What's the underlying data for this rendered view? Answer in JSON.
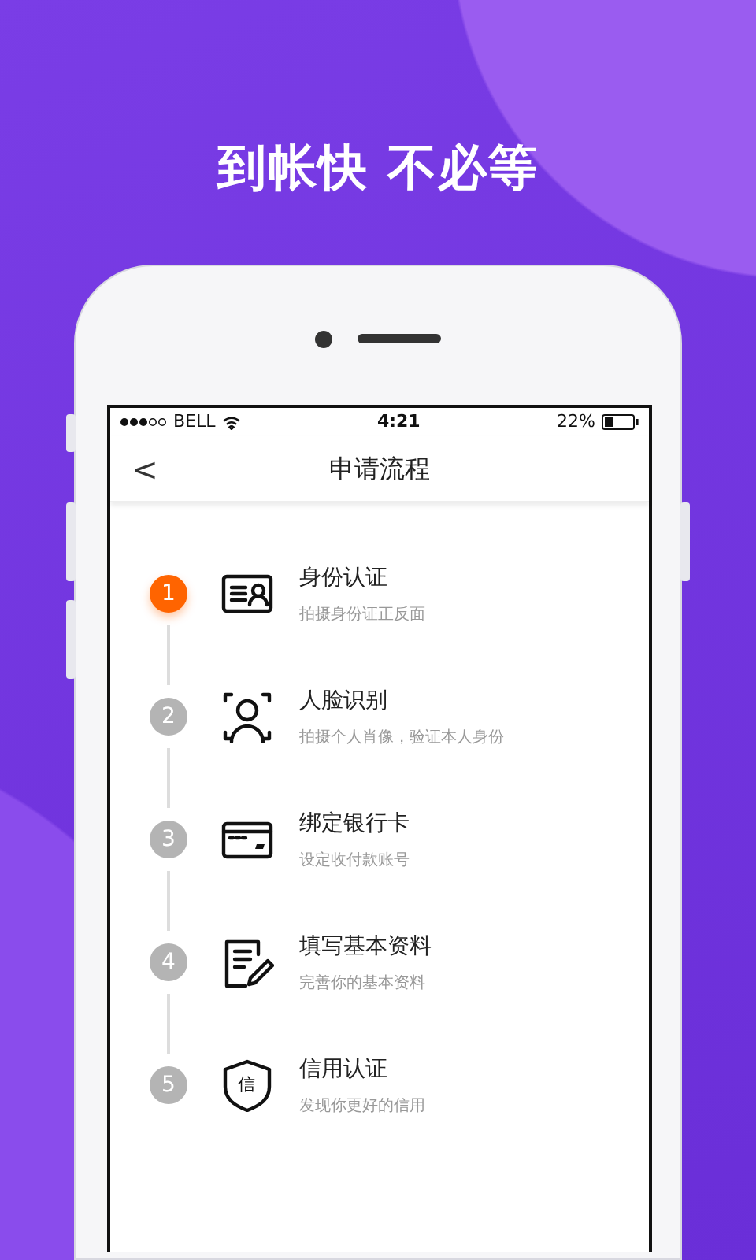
{
  "headline": "到帐快 不必等",
  "status_bar": {
    "carrier": "BELL",
    "time": "4:21",
    "battery": "22%"
  },
  "nav": {
    "back": "<",
    "title": "申请流程"
  },
  "steps": [
    {
      "number": "1",
      "title": "身份认证",
      "subtitle": "拍摄身份证正反面",
      "selected": true
    },
    {
      "number": "2",
      "title": "人脸识别",
      "subtitle": "拍摄个人肖像，验证本人身份",
      "selected": false
    },
    {
      "number": "3",
      "title": "绑定银行卡",
      "subtitle": "设定收付款账号",
      "selected": false
    },
    {
      "number": "4",
      "title": "填写基本资料",
      "subtitle": "完善你的基本资料",
      "selected": false
    },
    {
      "number": "5",
      "title": "信用认证",
      "subtitle": "发现你更好的信用",
      "selected": false,
      "icon_text": "信"
    }
  ]
}
